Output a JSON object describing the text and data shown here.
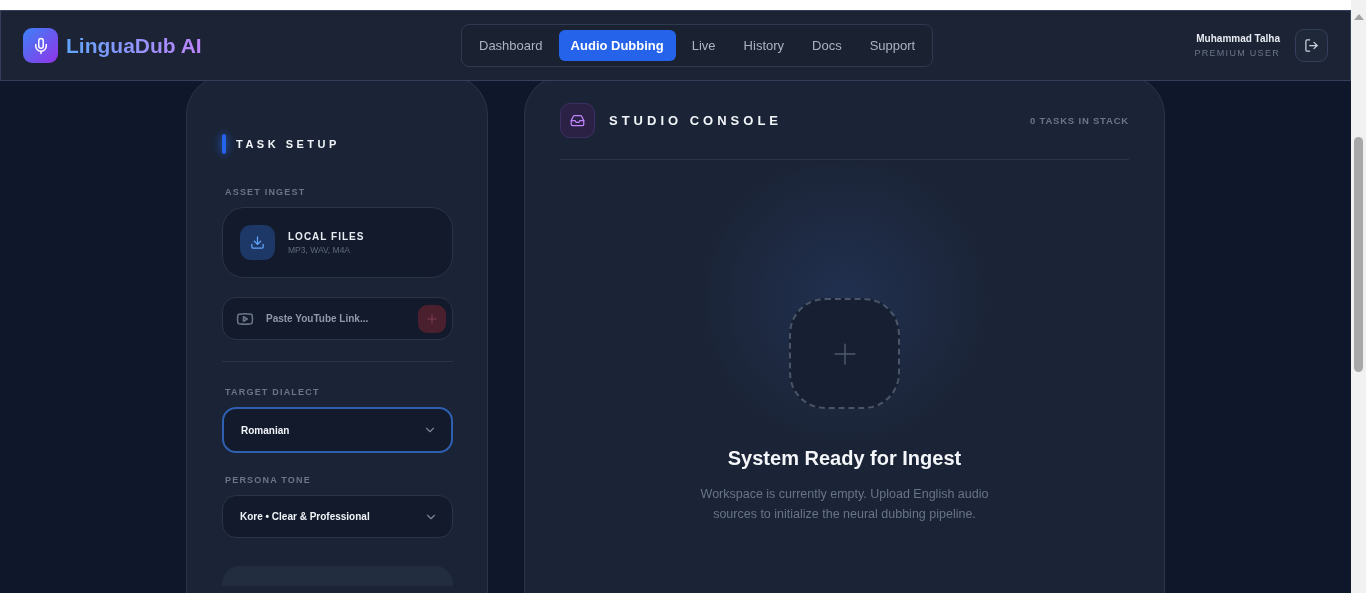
{
  "header": {
    "brand": "LinguaDub AI",
    "nav": [
      {
        "label": "Dashboard",
        "selected": false
      },
      {
        "label": "Audio Dubbing",
        "selected": true
      },
      {
        "label": "Live",
        "selected": false
      },
      {
        "label": "History",
        "selected": false
      },
      {
        "label": "Docs",
        "selected": false
      },
      {
        "label": "Support",
        "selected": false
      }
    ],
    "user": {
      "name": "Muhammad Talha",
      "role": "PREMIUM USER"
    }
  },
  "task_setup": {
    "title": "TASK SETUP",
    "asset_label": "ASSET INGEST",
    "local_files": {
      "title": "LOCAL FILES",
      "formats": "MP3, WAV, M4A"
    },
    "youtube": {
      "placeholder": "Paste YouTube Link..."
    },
    "dialect": {
      "label": "TARGET DIALECT",
      "value": "Romanian",
      "focused": true
    },
    "persona": {
      "label": "PERSONA TONE",
      "value": "Kore • Clear & Professional",
      "focused": false
    }
  },
  "console": {
    "title": "STUDIO CONSOLE",
    "count": "0 TASKS IN STACK",
    "empty_title": "System Ready for Ingest",
    "empty_text": "Workspace is currently empty. Upload English audio sources to initialize the neural dubbing pipeline."
  }
}
